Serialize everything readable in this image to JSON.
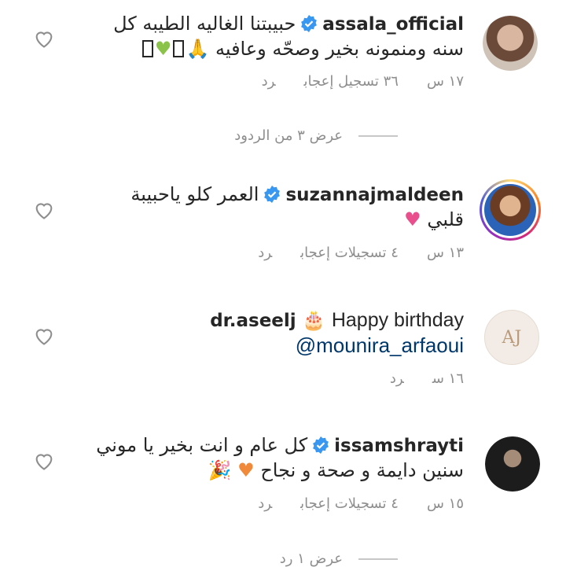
{
  "comments": [
    {
      "username": "assala_official",
      "verified": true,
      "line1": "حبيبتنا الغاليه الطيبه كل",
      "line2": "سنه ومنمونه بخير وصحّه وعافيه",
      "time": "١٧ س",
      "likes": "٣٦ تسجيل إعجاب",
      "reply": "رد",
      "view_replies": "عرض ٣ من الردود"
    },
    {
      "username": "suzannajmaldeen",
      "verified": true,
      "line1": "العمر كلو ياحبيبة",
      "line2": "قلبي",
      "time": "١٣ س",
      "likes": "٤ تسجيلات إعجاب",
      "reply": "رد"
    },
    {
      "username": "dr.aseelj",
      "verified": false,
      "line1": "Happy birthday",
      "line2": "@mounira_arfaoui",
      "time": "١٦ س",
      "reply": "رد"
    },
    {
      "username": "issamshrayti",
      "verified": true,
      "line1": "كل عام و انت بخير يا موني",
      "line2": "سنين دايمة و صحة و نجاح",
      "time": "١٥ س",
      "likes": "٤ تسجيلات إعجاب",
      "reply": "رد",
      "view_replies": "عرض ١ رد"
    }
  ],
  "colors": {
    "verified": "#3897f0",
    "meta": "#8e8e8e",
    "mention": "#00376b"
  },
  "icons": [
    "heart-outline-icon",
    "verified-badge-icon"
  ]
}
